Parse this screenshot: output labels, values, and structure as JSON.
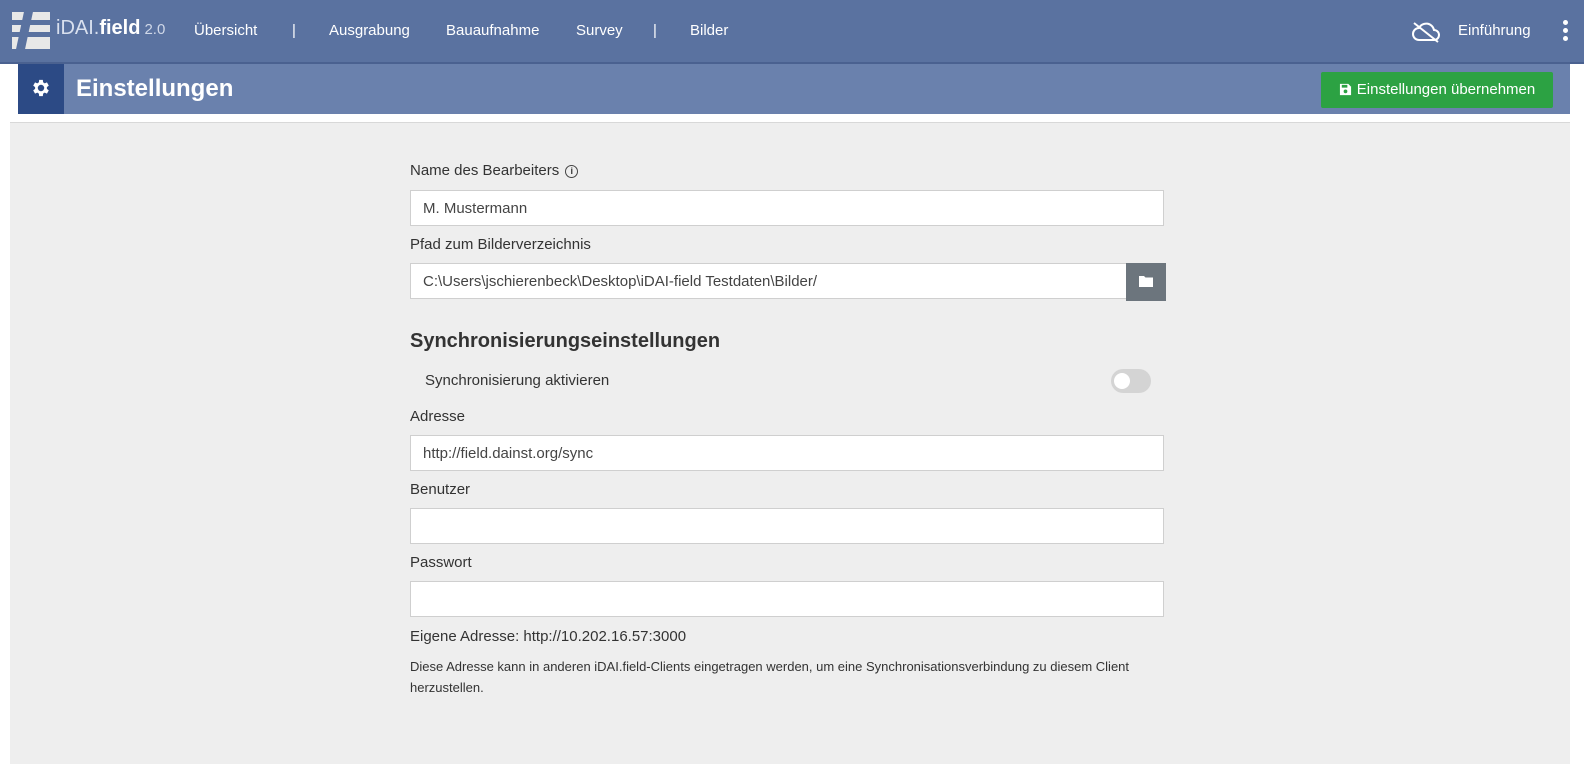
{
  "header": {
    "brand_prefix": "iDAI.",
    "brand_name": "field",
    "brand_version": "2.0",
    "nav": [
      "Übersicht",
      "Ausgrabung",
      "Bauaufnahme",
      "Survey",
      "Bilder"
    ],
    "separator": "|",
    "intro_label": "Einführung",
    "cloud_icon": "cloud-off-icon",
    "menu_icon": "vertical-dots-icon"
  },
  "subheader": {
    "title": "Einstellungen",
    "apply_label": "Einstellungen übernehmen",
    "settings_icon": "gear-icon",
    "save_icon": "floppy-disk-icon"
  },
  "form": {
    "editor_label": "Name des Bearbeiters",
    "editor_value": "M. Mustermann",
    "image_path_label": "Pfad zum Bilderverzeichnis",
    "image_path_value": "C:\\Users\\jschierenbeck\\Desktop\\iDAI-field Testdaten\\Bilder/",
    "sync_heading": "Synchronisierungseinstellungen",
    "sync_toggle_label": "Synchronisierung aktivieren",
    "sync_enabled": false,
    "address_label": "Adresse",
    "address_value": "http://field.dainst.org/sync",
    "user_label": "Benutzer",
    "user_value": "",
    "password_label": "Passwort",
    "password_value": "",
    "own_address": "Eigene Adresse: http://10.202.16.57:3000",
    "own_address_hint": "Diese Adresse kann in anderen iDAI.field-Clients eingetragen werden, um eine Synchronisationsverbindung zu diesem Client herzustellen."
  },
  "colors": {
    "navbar": "#5a72a0",
    "subbar": "#6a81ad",
    "gear_box": "#2c4a85",
    "apply_button": "#2ca243",
    "folder_button": "#6c757d",
    "content_bg": "#eeeeee"
  }
}
